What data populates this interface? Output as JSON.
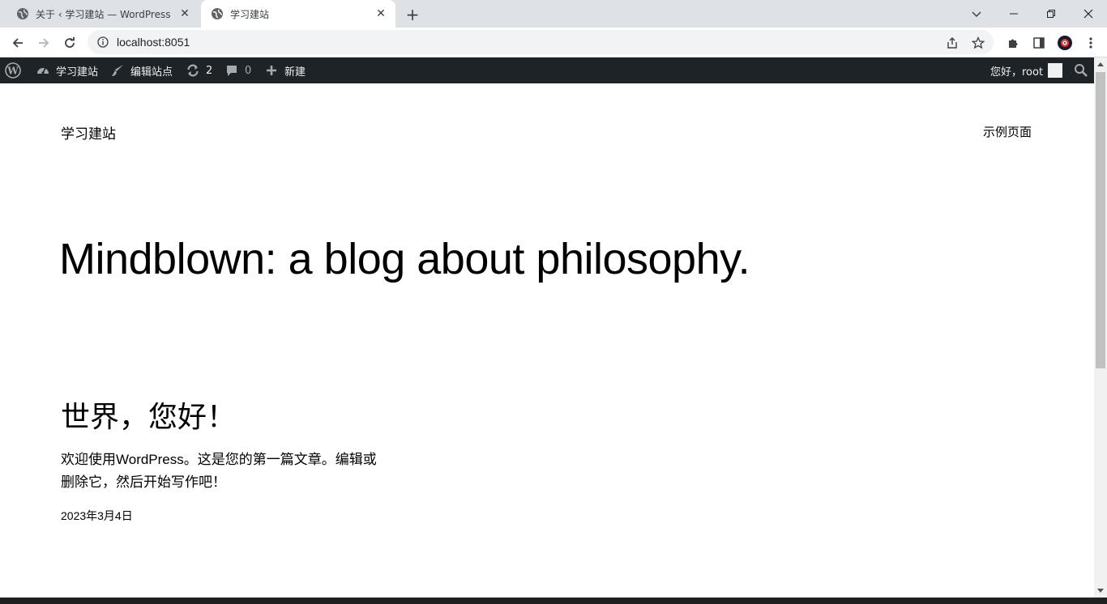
{
  "browser": {
    "tabs": [
      {
        "title": "关于 ‹ 学习建站 — WordPress",
        "active": false
      },
      {
        "title": "学习建站",
        "active": true
      }
    ],
    "url": "localhost:8051"
  },
  "adminbar": {
    "site_name": "学习建站",
    "customize": "编辑站点",
    "updates_count": "2",
    "comments_count": "0",
    "new": "新建",
    "greeting": "您好，root"
  },
  "site": {
    "title": "学习建站",
    "nav": [
      "示例页面"
    ],
    "hero": "Mindblown: a blog about philosophy."
  },
  "post": {
    "title": "世界，您好！",
    "excerpt": "欢迎使用WordPress。这是您的第一篇文章。编辑或删除它，然后开始写作吧！",
    "date": "2023年3月4日"
  },
  "colors": {
    "adminbar_bg": "#1d2327",
    "tabstrip_bg": "#dee1e6"
  }
}
